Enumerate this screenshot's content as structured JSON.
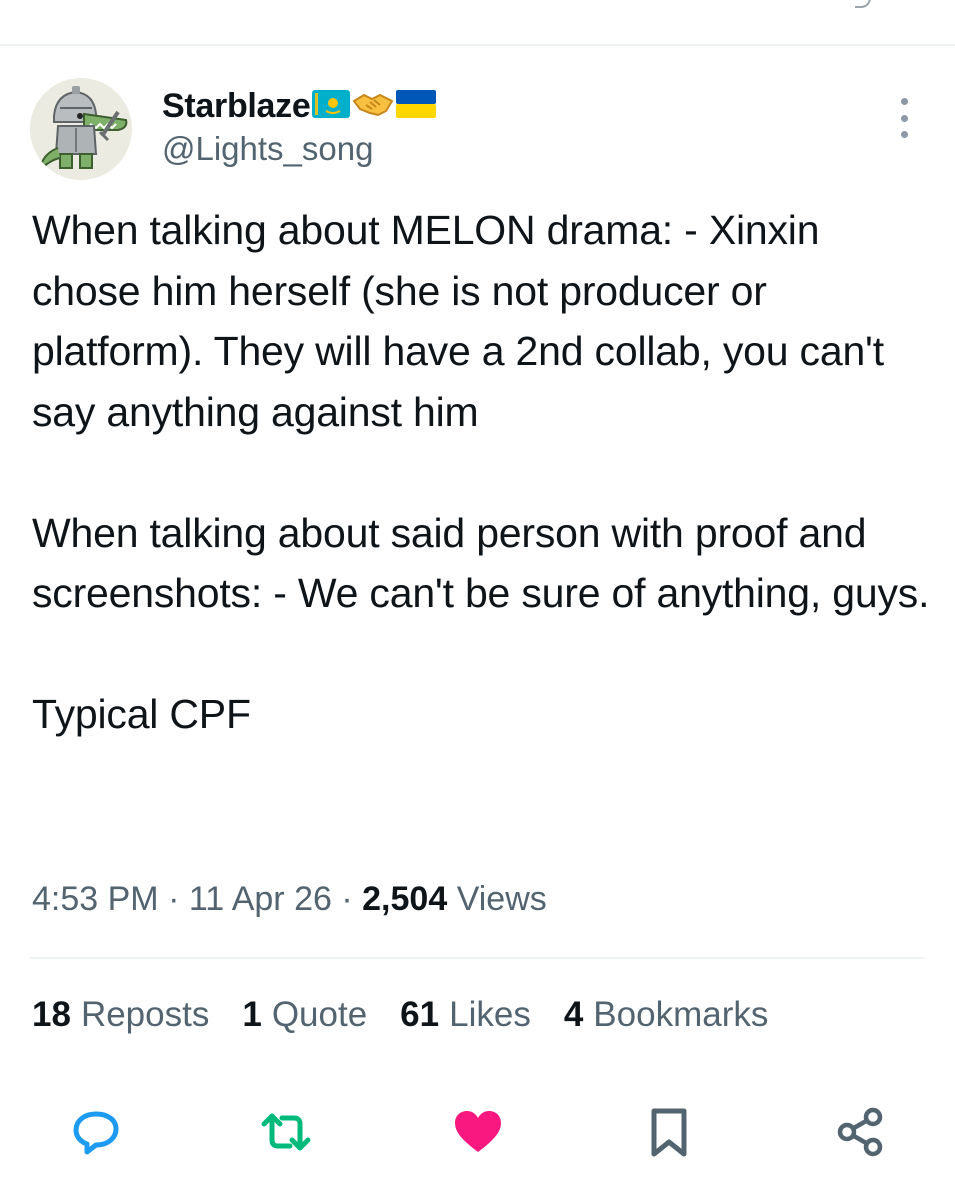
{
  "author": {
    "display_name": "Starblaze",
    "handle": "@Lights_song",
    "name_emoji": [
      "kazakhstan-flag",
      "handshake",
      "ukraine-flag"
    ]
  },
  "tweet": {
    "paragraphs": [
      "When talking about MELON drama: - Xinxin chose him herself (she is not producer or platform). They will have a 2nd collab, you can't say anything against him",
      "When talking about said person with proof and screenshots: - We can't be sure of anything, guys.",
      "Typical CPF"
    ],
    "time": "4:53 PM",
    "separator": "·",
    "date": "11 Apr 26",
    "views_count": "2,504",
    "views_label": "Views"
  },
  "stats": [
    {
      "count": "18",
      "label": "Reposts"
    },
    {
      "count": "1",
      "label": "Quote"
    },
    {
      "count": "61",
      "label": "Likes"
    },
    {
      "count": "4",
      "label": "Bookmarks"
    }
  ],
  "actions": [
    "reply-icon",
    "repost-icon",
    "like-icon-filled",
    "bookmark-icon",
    "share-icon"
  ],
  "colors": {
    "text": "#0f1419",
    "secondary_text": "#536471",
    "repost_green": "#00ba7c",
    "like_pink": "#f91880",
    "divider": "#eff3f4"
  }
}
